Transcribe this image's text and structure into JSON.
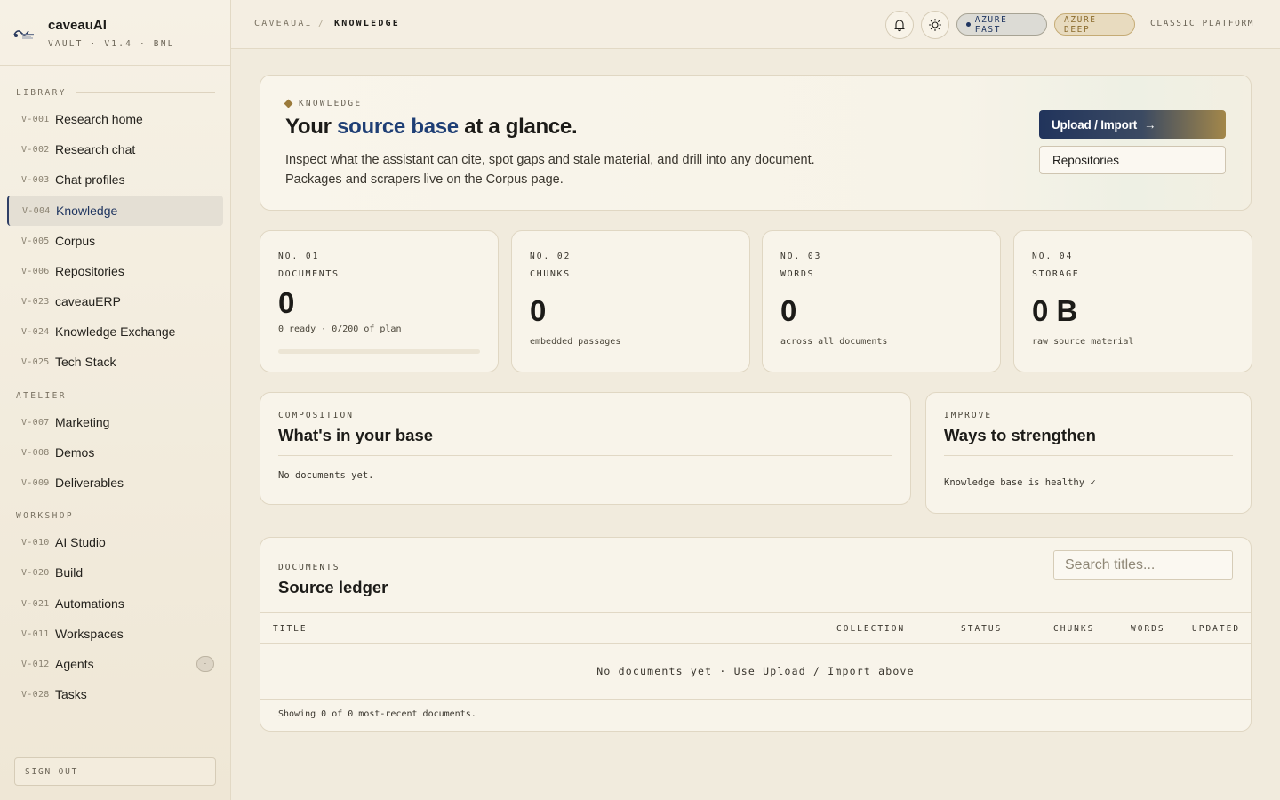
{
  "brand": {
    "name": "caveauAI",
    "subtitle": "VAULT · V1.4 · BNL"
  },
  "sidebar": {
    "sections": [
      {
        "label": "LIBRARY",
        "items": [
          {
            "code": "V-001",
            "label": "Research home"
          },
          {
            "code": "V-002",
            "label": "Research chat"
          },
          {
            "code": "V-003",
            "label": "Chat profiles"
          },
          {
            "code": "V-004",
            "label": "Knowledge",
            "active": true
          },
          {
            "code": "V-005",
            "label": "Corpus"
          },
          {
            "code": "V-006",
            "label": "Repositories"
          },
          {
            "code": "V-023",
            "label": "caveauERP"
          },
          {
            "code": "V-024",
            "label": "Knowledge Exchange"
          },
          {
            "code": "V-025",
            "label": "Tech Stack"
          }
        ]
      },
      {
        "label": "ATELIER",
        "items": [
          {
            "code": "V-007",
            "label": "Marketing"
          },
          {
            "code": "V-008",
            "label": "Demos"
          },
          {
            "code": "V-009",
            "label": "Deliverables"
          }
        ]
      },
      {
        "label": "WORKSHOP",
        "items": [
          {
            "code": "V-010",
            "label": "AI Studio"
          },
          {
            "code": "V-020",
            "label": "Build"
          },
          {
            "code": "V-021",
            "label": "Automations"
          },
          {
            "code": "V-011",
            "label": "Workspaces"
          },
          {
            "code": "V-012",
            "label": "Agents",
            "badge": "·"
          },
          {
            "code": "V-028",
            "label": "Tasks"
          }
        ]
      }
    ],
    "sign_out": "SIGN OUT"
  },
  "topbar": {
    "breadcrumb_root": "CAVEAUAI",
    "breadcrumb_sep": "/",
    "breadcrumb_current": "KNOWLEDGE",
    "notifications_icon": "bell-icon",
    "theme_icon": "sun-icon",
    "pill_fast": "AZURE FAST",
    "pill_deep": "AZURE DEEP",
    "classic_link": "CLASSIC PLATFORM"
  },
  "hero": {
    "kicker": "KNOWLEDGE",
    "title_pre": "Your ",
    "title_accent": "source base",
    "title_post": " at a glance.",
    "description": "Inspect what the assistant can cite, spot gaps and stale material, and drill into any document. Packages and scrapers live on the Corpus page.",
    "upload_label": "Upload / Import",
    "upload_arrow": "→",
    "repos_label": "Repositories"
  },
  "stats": [
    {
      "no": "NO. 01",
      "label": "DOCUMENTS",
      "value": "0",
      "caption": "0 ready · 0/200 of plan",
      "plan_fraction": 0
    },
    {
      "no": "NO. 02",
      "label": "CHUNKS",
      "value": "0",
      "caption": "embedded passages"
    },
    {
      "no": "NO. 03",
      "label": "WORDS",
      "value": "0",
      "caption": "across all documents"
    },
    {
      "no": "NO. 04",
      "label": "STORAGE",
      "value": "0 B",
      "caption": "raw source material"
    }
  ],
  "composition": {
    "kicker": "COMPOSITION",
    "title": "What's in your base",
    "text": "No documents yet."
  },
  "improve": {
    "kicker": "IMPROVE",
    "title": "Ways to strengthen",
    "text": "Knowledge base is healthy ✓"
  },
  "ledger": {
    "kicker": "DOCUMENTS",
    "title": "Source ledger",
    "search_placeholder": "Search titles...",
    "columns": [
      "TITLE",
      "COLLECTION",
      "STATUS",
      "CHUNKS",
      "WORDS",
      "UPDATED"
    ],
    "empty_text": "No documents yet · Use Upload / Import above",
    "footer": "Showing 0 of 0 most-recent documents."
  },
  "colors": {
    "accent": "#1f3f75",
    "gold": "#a3874a",
    "background": "#f1ebdd"
  }
}
